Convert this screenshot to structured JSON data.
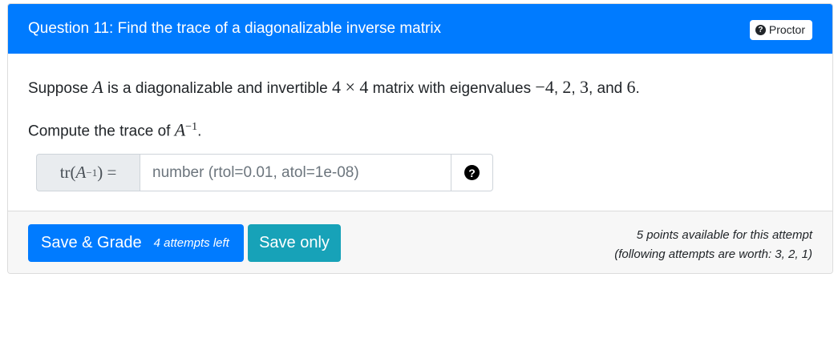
{
  "header": {
    "title": "Question 11: Find the trace of a diagonalizable inverse matrix",
    "proctor_label": "Proctor"
  },
  "body": {
    "p1_before": "Suppose ",
    "p1_var": "A",
    "p1_mid": " is a diagonalizable and invertible ",
    "p1_dim": "4 × 4",
    "p1_mid2": " matrix with eigenvalues ",
    "eigenvalues": [
      "−4",
      "2",
      "3",
      "6"
    ],
    "sep1": ", ",
    "sep2": ", ",
    "sep3": ", and ",
    "end": ".",
    "p2_before": "Compute the trace of ",
    "p2_var": "A",
    "p2_exp": "−1",
    "p2_end": ".",
    "input": {
      "label_tr": "tr(",
      "label_var": "A",
      "label_exp": "−1",
      "label_end": ") =",
      "placeholder": "number (rtol=0.01, atol=1e-08)",
      "value": ""
    }
  },
  "footer": {
    "grade_label": "Save & Grade",
    "attempts_left": "4 attempts left",
    "save_label": "Save only",
    "points_line1": "5 points available for this attempt",
    "points_line2": "(following attempts are worth: 3, 2, 1)"
  },
  "colors": {
    "primary": "#007bff",
    "info": "#17a2b8",
    "footer_bg": "#f7f7f7"
  }
}
